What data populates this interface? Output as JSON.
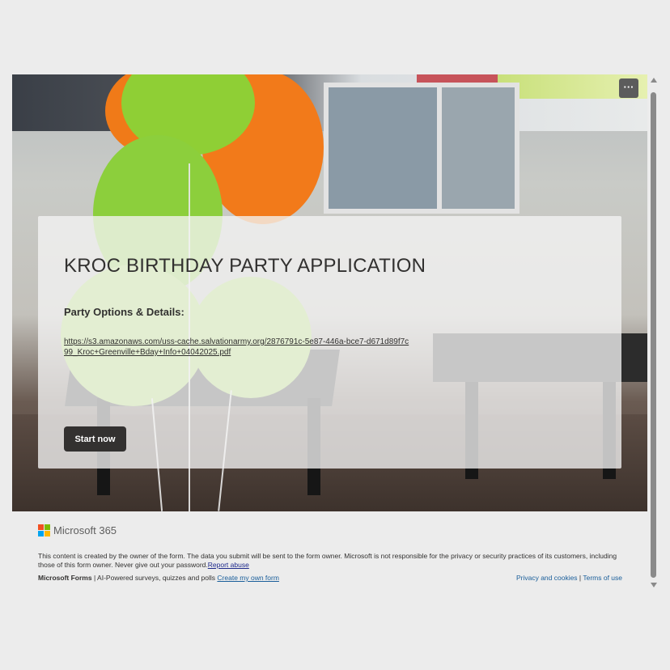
{
  "form": {
    "title": "KROC BIRTHDAY PARTY APPLICATION",
    "subtitle": "Party Options & Details:",
    "link": "https://s3.amazonaws.com/uss-cache.salvationarmy.org/2876791c-5e87-446a-bce7-d671d89f7c99_Kroc+Greenville+Bday+Info+04042025.pdf",
    "start_label": "Start now",
    "more_label": "···"
  },
  "footer": {
    "brand": "Microsoft 365",
    "disclaimer": "This content is created by the owner of the form. The data you submit will be sent to the form owner. Microsoft is not responsible for the privacy or security practices of its customers, including those of this form owner. Never give out your password.",
    "report_abuse": "Report abuse",
    "forms_brand": "Microsoft Forms",
    "forms_tagline": " | AI-Powered surveys, quizzes and polls ",
    "create_link": "Create my own form",
    "privacy": "Privacy and cookies",
    "separator": " | ",
    "terms": "Terms of use"
  },
  "colors": {
    "start_button": "#333130",
    "ms_red": "#f25022",
    "ms_green": "#7fba00",
    "ms_blue": "#00a4ef",
    "ms_yellow": "#ffb900"
  }
}
